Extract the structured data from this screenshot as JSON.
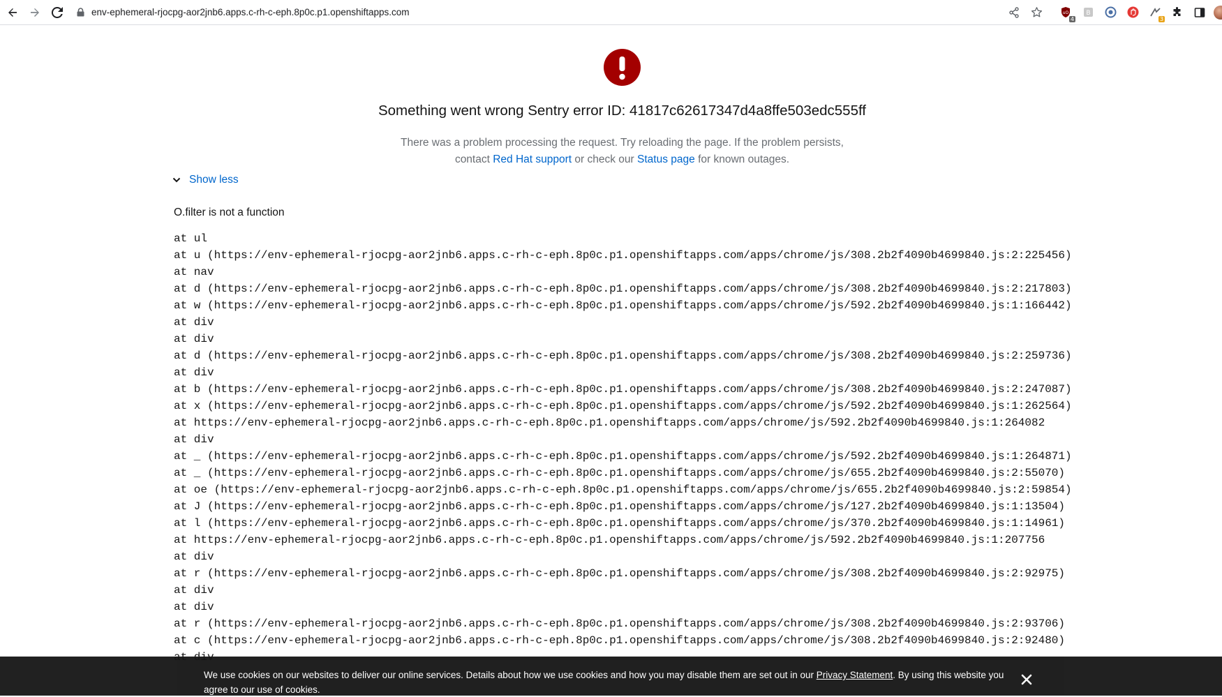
{
  "browser": {
    "url": "env-ephemeral-rjocpg-aor2jnb6.apps.c-rh-c-eph.8p0c.p1.openshiftapps.com",
    "extension_badges": [
      "4",
      "3"
    ],
    "icons": {
      "back": "arrow-left-icon",
      "forward": "arrow-right-icon",
      "reload": "reload-icon",
      "lock": "lock-icon",
      "share": "share-icon",
      "bookmark": "star-icon",
      "extensions": "puzzle-icon",
      "sidepanel": "side-panel-icon"
    }
  },
  "error": {
    "title": "Something went wrong Sentry error ID: 41817c62617347d4a8ffe503edc555ff",
    "desc_1": "There was a problem processing the request. Try reloading the page. If the problem persists,",
    "desc_2a": "contact",
    "support_link": "Red Hat support",
    "desc_2b": "or check our",
    "status_link": "Status page",
    "desc_2c": "for known outages.",
    "toggle_label": "Show less",
    "message": "O.filter is not a function",
    "colors": {
      "icon_red": "#a30000",
      "link_blue": "#0066cc"
    }
  },
  "stack_lines": [
    "at ul",
    "at u (https://env-ephemeral-rjocpg-aor2jnb6.apps.c-rh-c-eph.8p0c.p1.openshiftapps.com/apps/chrome/js/308.2b2f4090b4699840.js:2:225456)",
    "at nav",
    "at d (https://env-ephemeral-rjocpg-aor2jnb6.apps.c-rh-c-eph.8p0c.p1.openshiftapps.com/apps/chrome/js/308.2b2f4090b4699840.js:2:217803)",
    "at w (https://env-ephemeral-rjocpg-aor2jnb6.apps.c-rh-c-eph.8p0c.p1.openshiftapps.com/apps/chrome/js/592.2b2f4090b4699840.js:1:166442)",
    "at div",
    "at div",
    "at d (https://env-ephemeral-rjocpg-aor2jnb6.apps.c-rh-c-eph.8p0c.p1.openshiftapps.com/apps/chrome/js/308.2b2f4090b4699840.js:2:259736)",
    "at div",
    "at b (https://env-ephemeral-rjocpg-aor2jnb6.apps.c-rh-c-eph.8p0c.p1.openshiftapps.com/apps/chrome/js/308.2b2f4090b4699840.js:2:247087)",
    "at x (https://env-ephemeral-rjocpg-aor2jnb6.apps.c-rh-c-eph.8p0c.p1.openshiftapps.com/apps/chrome/js/592.2b2f4090b4699840.js:1:262564)",
    "at https://env-ephemeral-rjocpg-aor2jnb6.apps.c-rh-c-eph.8p0c.p1.openshiftapps.com/apps/chrome/js/592.2b2f4090b4699840.js:1:264082",
    "at div",
    "at _ (https://env-ephemeral-rjocpg-aor2jnb6.apps.c-rh-c-eph.8p0c.p1.openshiftapps.com/apps/chrome/js/592.2b2f4090b4699840.js:1:264871)",
    "at _ (https://env-ephemeral-rjocpg-aor2jnb6.apps.c-rh-c-eph.8p0c.p1.openshiftapps.com/apps/chrome/js/655.2b2f4090b4699840.js:2:55070)",
    "at oe (https://env-ephemeral-rjocpg-aor2jnb6.apps.c-rh-c-eph.8p0c.p1.openshiftapps.com/apps/chrome/js/655.2b2f4090b4699840.js:2:59854)",
    "at J (https://env-ephemeral-rjocpg-aor2jnb6.apps.c-rh-c-eph.8p0c.p1.openshiftapps.com/apps/chrome/js/127.2b2f4090b4699840.js:1:13504)",
    "at l (https://env-ephemeral-rjocpg-aor2jnb6.apps.c-rh-c-eph.8p0c.p1.openshiftapps.com/apps/chrome/js/370.2b2f4090b4699840.js:1:14961)",
    "at https://env-ephemeral-rjocpg-aor2jnb6.apps.c-rh-c-eph.8p0c.p1.openshiftapps.com/apps/chrome/js/592.2b2f4090b4699840.js:1:207756",
    "at div",
    "at r (https://env-ephemeral-rjocpg-aor2jnb6.apps.c-rh-c-eph.8p0c.p1.openshiftapps.com/apps/chrome/js/308.2b2f4090b4699840.js:2:92975)",
    "at div",
    "at div",
    "at r (https://env-ephemeral-rjocpg-aor2jnb6.apps.c-rh-c-eph.8p0c.p1.openshiftapps.com/apps/chrome/js/308.2b2f4090b4699840.js:2:93706)",
    "at c (https://env-ephemeral-rjocpg-aor2jnb6.apps.c-rh-c-eph.8p0c.p1.openshiftapps.com/apps/chrome/js/308.2b2f4090b4699840.js:2:92480)",
    "at div"
  ],
  "cookie_banner": {
    "text_1": "We use cookies on our websites to deliver our online services. Details about how we use cookies and how you may disable them are set out in our",
    "privacy_link": "Privacy Statement",
    "text_2": ". By using this website you agree to our use of cookies."
  }
}
